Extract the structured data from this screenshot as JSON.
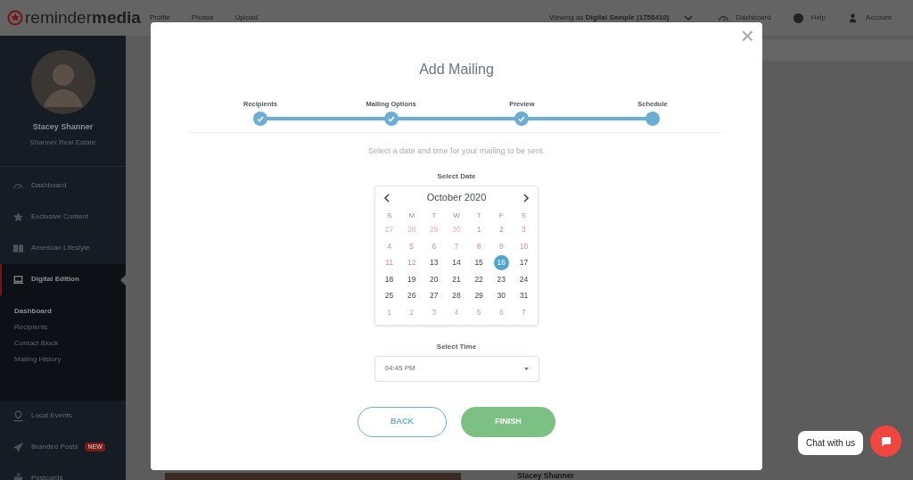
{
  "topbar": {
    "logo_light": "reminder",
    "logo_bold": "media",
    "nav": [
      "Profile",
      "Photos",
      "Upload"
    ],
    "viewing_prefix": "Viewing as ",
    "viewing_name": "Digital Sample (1758410)",
    "links": [
      {
        "label": "Dashboard"
      },
      {
        "label": "Help"
      },
      {
        "label": "Account"
      }
    ]
  },
  "sidebar": {
    "profile": {
      "name": "Stacey Shanner",
      "company": "Shanner Real Estate"
    },
    "items": [
      {
        "label": "Dashboard",
        "selected": false
      },
      {
        "label": "Exclusive Content",
        "selected": false
      },
      {
        "label": "American Lifestyle",
        "selected": false
      },
      {
        "label": "Digital Edition",
        "selected": true,
        "children": [
          {
            "label": "Dashboard",
            "selected": true
          },
          {
            "label": "Recipients",
            "selected": false
          },
          {
            "label": "Contact Block",
            "selected": false
          },
          {
            "label": "Mailing History",
            "selected": false
          }
        ]
      },
      {
        "label": "Local Events",
        "selected": false
      },
      {
        "label": "Branded Posts",
        "selected": false,
        "badge": "NEW"
      },
      {
        "label": "Postcards",
        "selected": false
      }
    ]
  },
  "background": {
    "name": "Stacey Shanner"
  },
  "modal": {
    "title": "Add Mailing",
    "close": "×",
    "steps": [
      {
        "label": "Recipients",
        "done": true
      },
      {
        "label": "Mailing Options",
        "done": true
      },
      {
        "label": "Preview",
        "done": true
      },
      {
        "label": "Schedule",
        "done": false
      }
    ],
    "instruction": "Select a date and time for your mailing to be sent.",
    "date_label": "Select Date",
    "month": "October 2020",
    "weekdays": [
      "S",
      "M",
      "T",
      "W",
      "T",
      "F",
      "S"
    ],
    "days": [
      {
        "label": "27",
        "kind": "outside_past",
        "selected": false
      },
      {
        "label": "28",
        "kind": "outside_past",
        "selected": false
      },
      {
        "label": "29",
        "kind": "outside_past",
        "selected": false
      },
      {
        "label": "30",
        "kind": "outside_past",
        "selected": false
      },
      {
        "label": "1",
        "kind": "past",
        "selected": false
      },
      {
        "label": "2",
        "kind": "past",
        "selected": false
      },
      {
        "label": "3",
        "kind": "past",
        "selected": false
      },
      {
        "label": "4",
        "kind": "past",
        "selected": false
      },
      {
        "label": "5",
        "kind": "past",
        "selected": false
      },
      {
        "label": "6",
        "kind": "past",
        "selected": false
      },
      {
        "label": "7",
        "kind": "past",
        "selected": false
      },
      {
        "label": "8",
        "kind": "past",
        "selected": false
      },
      {
        "label": "9",
        "kind": "past",
        "selected": false
      },
      {
        "label": "10",
        "kind": "past",
        "selected": false
      },
      {
        "label": "11",
        "kind": "past",
        "selected": false
      },
      {
        "label": "12",
        "kind": "past",
        "selected": false
      },
      {
        "label": "13",
        "kind": "open",
        "selected": false
      },
      {
        "label": "14",
        "kind": "open",
        "selected": false
      },
      {
        "label": "15",
        "kind": "open",
        "selected": false
      },
      {
        "label": "16",
        "kind": "open",
        "selected": true
      },
      {
        "label": "17",
        "kind": "open",
        "selected": false
      },
      {
        "label": "18",
        "kind": "open",
        "selected": false
      },
      {
        "label": "19",
        "kind": "open",
        "selected": false
      },
      {
        "label": "20",
        "kind": "open",
        "selected": false
      },
      {
        "label": "21",
        "kind": "open",
        "selected": false
      },
      {
        "label": "22",
        "kind": "open",
        "selected": false
      },
      {
        "label": "23",
        "kind": "open",
        "selected": false
      },
      {
        "label": "24",
        "kind": "open",
        "selected": false
      },
      {
        "label": "25",
        "kind": "open",
        "selected": false
      },
      {
        "label": "26",
        "kind": "open",
        "selected": false
      },
      {
        "label": "27",
        "kind": "open",
        "selected": false
      },
      {
        "label": "28",
        "kind": "open",
        "selected": false
      },
      {
        "label": "29",
        "kind": "open",
        "selected": false
      },
      {
        "label": "30",
        "kind": "open",
        "selected": false
      },
      {
        "label": "31",
        "kind": "open",
        "selected": false
      },
      {
        "label": "1",
        "kind": "outside_next",
        "selected": false
      },
      {
        "label": "2",
        "kind": "outside_next",
        "selected": false
      },
      {
        "label": "3",
        "kind": "outside_next",
        "selected": false
      },
      {
        "label": "4",
        "kind": "outside_next",
        "selected": false
      },
      {
        "label": "5",
        "kind": "outside_next",
        "selected": false
      },
      {
        "label": "6",
        "kind": "outside_next",
        "selected": false
      },
      {
        "label": "7",
        "kind": "outside_next",
        "selected": false
      }
    ],
    "time_label": "Select Time",
    "time_value": "04:45 PM",
    "back": "BACK",
    "finish": "FINISH"
  },
  "chat": {
    "label": "Chat with us"
  }
}
